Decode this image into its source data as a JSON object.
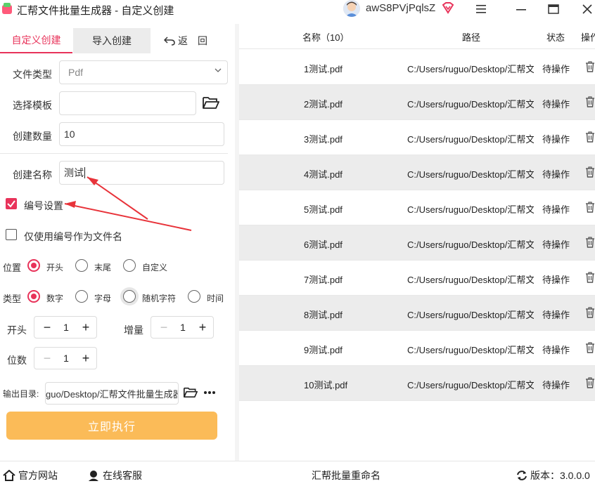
{
  "window": {
    "title": "汇帮文件批量生成器 - 自定义创建",
    "username": "awS8PVjPqlsZ"
  },
  "tabs": {
    "custom": "自定义创建",
    "import": "导入创建",
    "back": "返　回"
  },
  "form": {
    "file_type_label": "文件类型",
    "file_type_value": "Pdf",
    "template_label": "选择模板",
    "template_value": "",
    "count_label": "创建数量",
    "count_value": "10",
    "name_label": "创建名称",
    "name_value": "测试"
  },
  "numbering": {
    "enable_label": "编号设置",
    "enabled": true,
    "only_number_label": "仅使用编号作为文件名",
    "only_number": false,
    "position_label": "位置",
    "position_options": [
      "开头",
      "末尾",
      "自定义"
    ],
    "position_selected": "开头",
    "type_label": "类型",
    "type_options": [
      "数字",
      "字母",
      "随机字符",
      "时间"
    ],
    "type_selected": "数字",
    "start_label": "开头",
    "start_value": "1",
    "increment_label": "增量",
    "increment_value": "1",
    "digits_label": "位数",
    "digits_value": "1"
  },
  "output": {
    "label": "输出目录:",
    "path": "guo/Desktop/汇帮文件批量生成器"
  },
  "execute_label": "立即执行",
  "table": {
    "headers": {
      "name": "名称（10）",
      "path": "路径",
      "status": "状态",
      "actions": "操作"
    },
    "rows": [
      {
        "name": "1测试.pdf",
        "path": "C:/Users/ruguo/Desktop/汇帮文",
        "status": "待操作"
      },
      {
        "name": "2测试.pdf",
        "path": "C:/Users/ruguo/Desktop/汇帮文",
        "status": "待操作"
      },
      {
        "name": "3测试.pdf",
        "path": "C:/Users/ruguo/Desktop/汇帮文",
        "status": "待操作"
      },
      {
        "name": "4测试.pdf",
        "path": "C:/Users/ruguo/Desktop/汇帮文",
        "status": "待操作"
      },
      {
        "name": "5测试.pdf",
        "path": "C:/Users/ruguo/Desktop/汇帮文",
        "status": "待操作"
      },
      {
        "name": "6测试.pdf",
        "path": "C:/Users/ruguo/Desktop/汇帮文",
        "status": "待操作"
      },
      {
        "name": "7测试.pdf",
        "path": "C:/Users/ruguo/Desktop/汇帮文",
        "status": "待操作"
      },
      {
        "name": "8测试.pdf",
        "path": "C:/Users/ruguo/Desktop/汇帮文",
        "status": "待操作"
      },
      {
        "name": "9测试.pdf",
        "path": "C:/Users/ruguo/Desktop/汇帮文",
        "status": "待操作"
      },
      {
        "name": "10测试.pdf",
        "path": "C:/Users/ruguo/Desktop/汇帮文",
        "status": "待操作"
      }
    ]
  },
  "footer": {
    "website": "官方网站",
    "support": "在线客服",
    "rename": "汇帮批量重命名",
    "version": "版本：3.0.0.0"
  },
  "colors": {
    "accent": "#e8335a",
    "execute": "#fbbb58",
    "annotation_arrow": "#e8333a"
  }
}
